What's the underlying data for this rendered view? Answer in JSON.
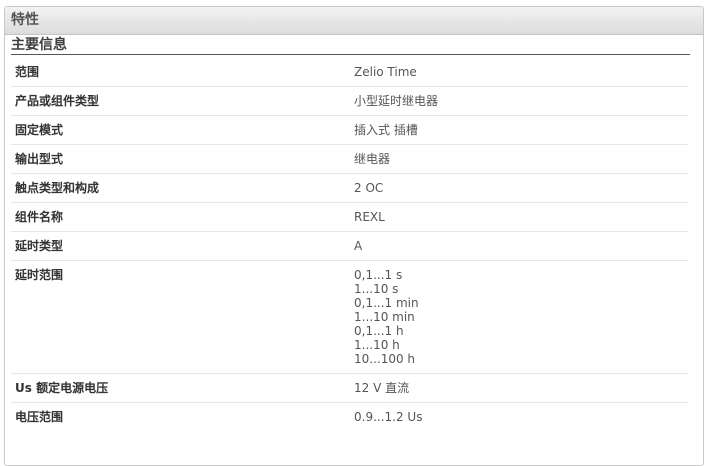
{
  "panel": {
    "title": "特性"
  },
  "section": {
    "title": "主要信息"
  },
  "rows": [
    {
      "label": "范围",
      "value": "Zelio Time"
    },
    {
      "label": "产品或组件类型",
      "value": "小型延时继电器"
    },
    {
      "label": "固定模式",
      "value": "插入式 插槽"
    },
    {
      "label": "输出型式",
      "value": "继电器"
    },
    {
      "label": "触点类型和构成",
      "value": "2 OC"
    },
    {
      "label": "组件名称",
      "value": "REXL"
    },
    {
      "label": "延时类型",
      "value": "A"
    },
    {
      "label": "延时范围",
      "values": [
        "0,1...1 s",
        "1...10 s",
        "0,1...1 min",
        "1...10 min",
        "0,1...1 h",
        "1...10 h",
        "10...100 h"
      ]
    },
    {
      "label": "Us 额定电源电压",
      "value": "12 V 直流"
    },
    {
      "label": "电压范围",
      "value": "0.9...1.2 Us"
    }
  ]
}
